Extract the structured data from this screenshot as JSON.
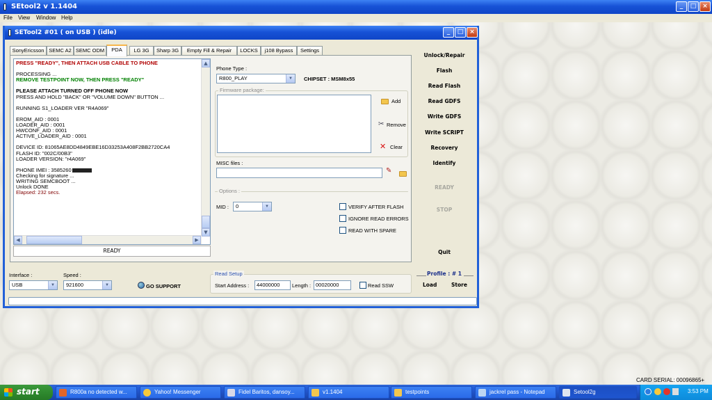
{
  "window": {
    "title": "SEtool2 v 1.1404",
    "controls": {
      "minimize": "_",
      "maximize": "□",
      "close": "×"
    }
  },
  "menu": [
    "File",
    "View",
    "Window",
    "Help"
  ],
  "child": {
    "title": "SETool2 #01 ( on USB ) (idle)"
  },
  "tabs": [
    "SonyEricsson",
    "SEMC A2",
    "SEMC ODM",
    "PDA",
    "LG 3G",
    "Sharp 3G",
    "Empty Fill & Repair",
    "LOCKS",
    "j108 Bypass",
    "Settings"
  ],
  "active_tab": "PDA",
  "log": [
    {
      "style": "red",
      "text": "PRESS \"READY\", THEN ATTACH USB CABLE TO PHONE"
    },
    {
      "style": "",
      "text": ""
    },
    {
      "style": "",
      "text": "PROCESSING ..."
    },
    {
      "style": "green",
      "text": "REMOVE TESTPOINT NOW, THEN PRESS \"READY\""
    },
    {
      "style": "",
      "text": ""
    },
    {
      "style": "b",
      "text": "PLEASE ATTACH TURNED OFF PHONE NOW"
    },
    {
      "style": "",
      "text": "PRESS AND HOLD \"BACK\" OR \"VOLUME DOWN\" BUTTON ..."
    },
    {
      "style": "",
      "text": ""
    },
    {
      "style": "",
      "text": "RUNNING S1_LOADER VER \"R4A069\""
    },
    {
      "style": "",
      "text": ""
    },
    {
      "style": "",
      "text": "EROM_AID : 0001"
    },
    {
      "style": "",
      "text": "LOADER_AID : 0001"
    },
    {
      "style": "",
      "text": "HWCONF_AID : 0001"
    },
    {
      "style": "",
      "text": "ACTIVE_LOADER_AID : 0001"
    },
    {
      "style": "",
      "text": ""
    },
    {
      "style": "",
      "text": "DEVICE ID: 81065AE8DD4849EBE16D33253A408F2BB2720CA4"
    },
    {
      "style": "",
      "text": "FLASH ID: \"002C/00B3\""
    },
    {
      "style": "",
      "text": "LOADER VERSION: \"r4A069\""
    },
    {
      "style": "",
      "text": ""
    },
    {
      "style": "",
      "text": "PHONE IMEI : 3585260"
    },
    {
      "style": "",
      "text": "Checking for signature ..."
    },
    {
      "style": "",
      "text": "WRITING SEMCBOOT ..."
    },
    {
      "style": "",
      "text": "Unlock DONE"
    },
    {
      "style": "dk",
      "text": "Elapsed: 232 secs."
    }
  ],
  "log_status": "READY",
  "phone_type": {
    "label": "Phone Type :",
    "value": "R800_PLAY"
  },
  "chipset": "CHIPSET : MSM8x55",
  "firmware": {
    "label": "Firmware package:",
    "add": "Add",
    "remove": "Remove",
    "clear": "Clear"
  },
  "misc": {
    "label": "MISC files :"
  },
  "options": {
    "label": "Options :",
    "mid_label": "MID :",
    "mid_value": "0",
    "verify": "VERIFY AFTER FLASH",
    "ignore": "IGNORE READ ERRORS",
    "spare": "READ WITH SPARE"
  },
  "side": {
    "unlock": "Unlock/Repair",
    "flash": "Flash",
    "read_flash": "Read Flash",
    "read_gdfs": "Read GDFS",
    "write_gdfs": "Write GDFS",
    "write_script": "Write SCRIPT",
    "recovery": "Recovery",
    "identify": "Identify",
    "ready": "READY",
    "stop": "STOP",
    "quit": "Quit",
    "profile": "Profile : # 1",
    "load": "Load",
    "store": "Store"
  },
  "interface": {
    "label": "Interface :",
    "value": "USB"
  },
  "speed": {
    "label": "Speed :",
    "value": "921600"
  },
  "support": "GO SUPPORT",
  "read_setup": {
    "label": "Read Setup",
    "start_label": "Start Address :",
    "start_value": "44000000",
    "length_label": "Length :",
    "length_value": "00020000",
    "ssw": "Read SSW"
  },
  "card_serial": "CARD SERIAL: 00096865+",
  "taskbar": {
    "start": "start",
    "clock": "3:53 PM",
    "items": [
      "R800a no detected w...",
      "Yahoo! Messenger",
      "Fidel Baritos, dansoy...",
      "v1.1404",
      "testpoints",
      "jackrel pass - Notepad",
      "Setool2g"
    ]
  },
  "colors": {
    "xp_blue": "#1752d6",
    "start_green": "#2f8a2f",
    "log_red": "#b00000",
    "log_green": "#008000",
    "disabled": "#a8a8a0"
  }
}
